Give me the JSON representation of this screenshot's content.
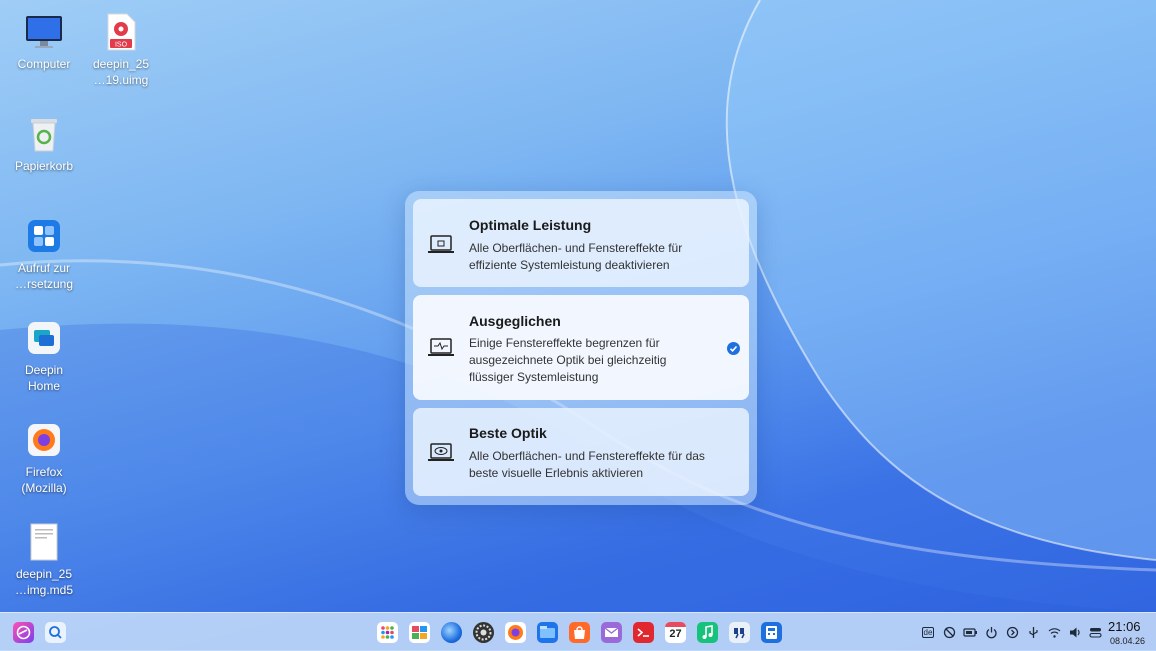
{
  "desktop": {
    "icons": [
      {
        "label_line1": "Computer",
        "label_line2": "",
        "icon": "computer-icon"
      },
      {
        "label_line1": "deepin_25",
        "label_line2": "…19.uimg",
        "icon": "iso-file-icon"
      },
      {
        "label_line1": "Papierkorb",
        "label_line2": "",
        "icon": "trash-icon"
      },
      {
        "label_line1": "Aufruf zur",
        "label_line2": "…rsetzung",
        "icon": "translation-icon"
      },
      {
        "label_line1": "Deepin",
        "label_line2": "Home",
        "icon": "deepin-home-icon"
      },
      {
        "label_line1": "Firefox",
        "label_line2": "(Mozilla)",
        "icon": "firefox-icon"
      },
      {
        "label_line1": "deepin_25",
        "label_line2": "…img.md5",
        "icon": "text-file-icon"
      }
    ],
    "iso_badge": "ISO"
  },
  "popup": {
    "modes": [
      {
        "title": "Optimale Leistung",
        "desc": "Alle Oberflächen- und Fenstereffekte für effiziente Systemleistung deaktivieren",
        "selected": false
      },
      {
        "title": "Ausgeglichen",
        "desc": "Einige Fenstereffekte begrenzen für ausgezeichnete Optik bei gleichzeitig flüssiger Systemleistung",
        "selected": true
      },
      {
        "title": "Beste Optik",
        "desc": "Alle Oberflächen- und Fenstereffekte für das beste visuelle Erlebnis aktivieren",
        "selected": false
      }
    ]
  },
  "taskbar": {
    "left": [
      "launcher-icon",
      "search-icon"
    ],
    "apps": [
      "app-grid-icon",
      "multitask-icon",
      "browser-icon",
      "settings-icon",
      "firefox-icon",
      "file-manager-icon",
      "app-store-icon",
      "mail-icon",
      "terminal-icon",
      "calendar-icon",
      "music-icon",
      "quotes-icon",
      "calculator-icon"
    ],
    "calendar_day": "27",
    "tray_keyboard": "de",
    "tray": [
      "keyboard-icon",
      "no-disturb-icon",
      "battery-icon",
      "power-icon",
      "media-icon",
      "usb-icon",
      "wifi-icon",
      "volume-icon",
      "control-center-icon"
    ],
    "clock_time": "21:06",
    "clock_date": "08.04.26"
  },
  "colors": {
    "accent": "#1e6fe0",
    "taskbar": "#c4dbf8"
  }
}
